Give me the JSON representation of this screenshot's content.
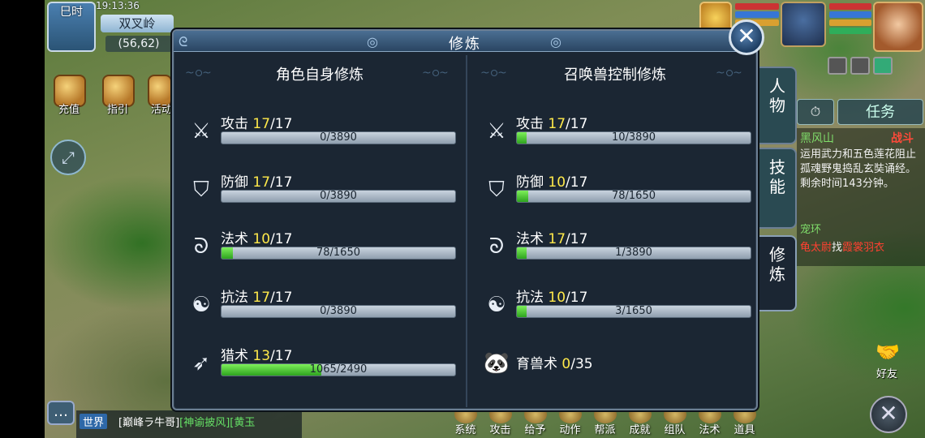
{
  "hud": {
    "time_label": "巳时",
    "clock": "19:13:36",
    "map_name": "双叉岭",
    "coords": "(56,62)",
    "left_icons": [
      {
        "label": "充值",
        "icon": "treasure-chest-icon"
      },
      {
        "label": "指引",
        "icon": "question-book-icon"
      },
      {
        "label": "活动",
        "icon": "activity-icon"
      }
    ]
  },
  "dialog": {
    "title": "修炼",
    "left_heading": "角色自身修炼",
    "right_heading": "召唤兽控制修炼",
    "left_rows": [
      {
        "icon": "sword-icon",
        "name": "攻击",
        "level": "17",
        "max": "/17",
        "progress": "0/3890",
        "fill_ratio": 0
      },
      {
        "icon": "shield-icon",
        "name": "防御",
        "level": "17",
        "max": "/17",
        "progress": "0/3890",
        "fill_ratio": 0
      },
      {
        "icon": "magic-swirl-icon",
        "name": "法术",
        "level": "10",
        "max": "/17",
        "progress": "78/1650",
        "fill_ratio": 0.047
      },
      {
        "icon": "yin-yang-icon",
        "name": "抗法",
        "level": "17",
        "max": "/17",
        "progress": "0/3890",
        "fill_ratio": 0
      },
      {
        "icon": "bow-icon",
        "name": "猎术",
        "level": "13",
        "max": "/17",
        "progress": "1065/2490",
        "fill_ratio": 0.428
      }
    ],
    "right_rows": [
      {
        "icon": "sword-icon",
        "name": "攻击",
        "level": "17",
        "max": "/17",
        "progress": "10/3890",
        "fill_ratio": 0.003
      },
      {
        "icon": "shield-icon",
        "name": "防御",
        "level": "10",
        "max": "/17",
        "progress": "78/1650",
        "fill_ratio": 0.047
      },
      {
        "icon": "magic-swirl-icon",
        "name": "法术",
        "level": "17",
        "max": "/17",
        "progress": "1/3890",
        "fill_ratio": 0.0003
      },
      {
        "icon": "yin-yang-icon",
        "name": "抗法",
        "level": "10",
        "max": "/17",
        "progress": "3/1650",
        "fill_ratio": 0.002
      }
    ],
    "pet_skill": {
      "icon": "panda-icon",
      "name": "育兽术",
      "level": "0",
      "max": "/35"
    }
  },
  "side_tabs": {
    "character": "人\n物",
    "skills": "技\n能",
    "cultivation": "修\n炼"
  },
  "task": {
    "timer_icon": "stopwatch-icon",
    "button": "任务",
    "location": "黑风山",
    "battle": "战斗",
    "description": "运用武力和五色莲花阻止孤魂野鬼捣乱玄奘诵经。剩余时间143分钟。",
    "sub_title": "宠环",
    "sub_line_prefix": "找",
    "sub_red1": "龟太尉",
    "sub_red2": "霞裳羽衣"
  },
  "friend_label": "好友",
  "chat": {
    "channel": "世界",
    "text": "[巅峰ラ牛哥]",
    "green_text": "[神谕披风][黄玉"
  },
  "menu": [
    "系统",
    "攻击",
    "给予",
    "动作",
    "帮派",
    "成就",
    "组队",
    "法术",
    "道具"
  ],
  "colors": {
    "level_highlight": "#ffe94a",
    "progress_fill": "#3fbf2a",
    "panel_bg": "#1b2633",
    "title_bar": "#3a5a7c"
  }
}
